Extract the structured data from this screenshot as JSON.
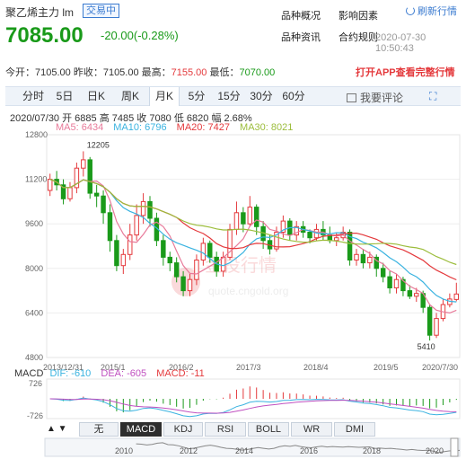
{
  "header": {
    "name": "聚乙烯主力 lm",
    "status_badge": "交易中",
    "links": [
      "品种概况",
      "影响因素",
      "品种资讯",
      "合约规则"
    ],
    "refresh_label": "刷新行情",
    "price": "7085.00",
    "change": "-20.00(-0.28%)",
    "timestamp": "2020-07-30 10:50:43"
  },
  "stats": {
    "open_label": "今开：",
    "open": "7105.00",
    "prev_close_label": "昨收：",
    "prev_close": "7105.00",
    "high_label": "最高：",
    "high": "7155.00",
    "low_label": "最低：",
    "low": "7070.00",
    "app_link": "打开APP查看完整行情"
  },
  "tabs": [
    "分时",
    "5日",
    "日K",
    "周K",
    "月K",
    "5分",
    "15分",
    "30分",
    "60分"
  ],
  "active_tab": "月K",
  "comment_label": "我要评论",
  "bar_info": "2020/07/30  开 6885  高 7485  收 7080  低 6820  幅 2.68%",
  "ma": [
    {
      "label": "MA5: 6434",
      "color": "#e87a9a"
    },
    {
      "label": "MA10: 6796",
      "color": "#3ab3e0"
    },
    {
      "label": "MA20: 7427",
      "color": "#e4393c"
    },
    {
      "label": "MA30: 8021",
      "color": "#9cbd3c"
    }
  ],
  "watermark": {
    "cn": "金投行情",
    "en": "quote.cngold.org"
  },
  "chart_data": {
    "type": "candlestick",
    "y_ticks": [
      "12800",
      "11200",
      "9600",
      "8000",
      "6400",
      "4800"
    ],
    "ylim": [
      4800,
      12800
    ],
    "x_ticks": [
      "2013/12/31",
      "2015/1",
      "2016/2",
      "2017/3",
      "2018/4",
      "2019/5",
      "2020/7/30"
    ],
    "annotations": [
      "12205",
      "5410"
    ],
    "candles": [
      [
        10800,
        11200,
        11400,
        10600
      ],
      [
        11200,
        11000,
        11500,
        10800
      ],
      [
        11000,
        10500,
        11200,
        10300
      ],
      [
        10500,
        10900,
        11100,
        10400
      ],
      [
        10900,
        11600,
        11800,
        10700
      ],
      [
        11600,
        11900,
        12205,
        11300
      ],
      [
        11900,
        10700,
        12000,
        10500
      ],
      [
        10700,
        10600,
        11000,
        10200
      ],
      [
        10600,
        10000,
        10800,
        9600
      ],
      [
        10000,
        9000,
        10300,
        8600
      ],
      [
        9000,
        8100,
        9200,
        7900
      ],
      [
        8100,
        8500,
        8700,
        7800
      ],
      [
        8500,
        9200,
        9600,
        8300
      ],
      [
        9200,
        9900,
        10300,
        9000
      ],
      [
        9900,
        10400,
        10700,
        9600
      ],
      [
        10400,
        9800,
        10600,
        9500
      ],
      [
        9800,
        9000,
        10000,
        8800
      ],
      [
        9000,
        8400,
        9200,
        8100
      ],
      [
        8400,
        8200,
        8600,
        7900
      ],
      [
        8200,
        7700,
        8400,
        7500
      ],
      [
        7700,
        7200,
        7900,
        7000
      ],
      [
        7200,
        7600,
        7800,
        7000
      ],
      [
        7600,
        8300,
        8500,
        7400
      ],
      [
        8300,
        8900,
        9100,
        8100
      ],
      [
        8900,
        8400,
        9000,
        8200
      ],
      [
        8400,
        7900,
        8600,
        7700
      ],
      [
        7900,
        8400,
        8600,
        7700
      ],
      [
        8400,
        9400,
        9600,
        8300
      ],
      [
        9400,
        10000,
        10400,
        9200
      ],
      [
        10000,
        9600,
        10200,
        9300
      ],
      [
        9600,
        10200,
        10600,
        9500
      ],
      [
        10200,
        9500,
        10300,
        9200
      ],
      [
        9500,
        9000,
        9700,
        8700
      ],
      [
        9000,
        8700,
        9200,
        8500
      ],
      [
        8700,
        9300,
        9500,
        8600
      ],
      [
        9300,
        9700,
        9900,
        9100
      ],
      [
        9700,
        9200,
        9800,
        9000
      ],
      [
        9200,
        9500,
        9700,
        9000
      ],
      [
        9500,
        9300,
        9700,
        9100
      ],
      [
        9300,
        9100,
        9400,
        8900
      ],
      [
        9100,
        9400,
        9600,
        9000
      ],
      [
        9400,
        9200,
        9700,
        9000
      ],
      [
        9200,
        9000,
        9500,
        8900
      ],
      [
        9000,
        9100,
        9300,
        8800
      ],
      [
        9100,
        9300,
        9500,
        9000
      ],
      [
        9300,
        8300,
        9400,
        8100
      ],
      [
        8300,
        8500,
        8700,
        8100
      ],
      [
        8500,
        8200,
        8700,
        8000
      ],
      [
        8200,
        8400,
        8600,
        8000
      ],
      [
        8400,
        8000,
        8500,
        7700
      ],
      [
        8000,
        7700,
        8200,
        7500
      ],
      [
        7700,
        7300,
        7900,
        7100
      ],
      [
        7300,
        7600,
        7800,
        7100
      ],
      [
        7600,
        7200,
        7700,
        7000
      ],
      [
        7200,
        7000,
        7400,
        6900
      ],
      [
        7000,
        7100,
        7300,
        6800
      ],
      [
        7100,
        6600,
        7200,
        6400
      ],
      [
        6600,
        5600,
        6700,
        5410
      ],
      [
        5600,
        6200,
        6400,
        5500
      ],
      [
        6200,
        6700,
        6900,
        6100
      ],
      [
        6700,
        6900,
        7100,
        6600
      ],
      [
        6885,
        7080,
        7485,
        6820
      ]
    ]
  },
  "macd": {
    "dif_label": "DIF: -610",
    "dif_color": "#3ab3e0",
    "dea_label": "DEA: -605",
    "dea_color": "#c050c0",
    "macd_label": "MACD: -11",
    "macd_color": "#e4393c",
    "top_tick": "726",
    "bottom_tick": "-726"
  },
  "indicator_tabs": [
    "无",
    "MACD",
    "KDJ",
    "RSI",
    "BOLL",
    "WR",
    "DMI"
  ],
  "active_indicator": "MACD",
  "mini_x": [
    "2010",
    "2012",
    "2014",
    "2016",
    "2018",
    "2020"
  ],
  "colors": {
    "up": "#e4393c",
    "down": "#1a9a1a",
    "accent": "#3b7bd0"
  }
}
